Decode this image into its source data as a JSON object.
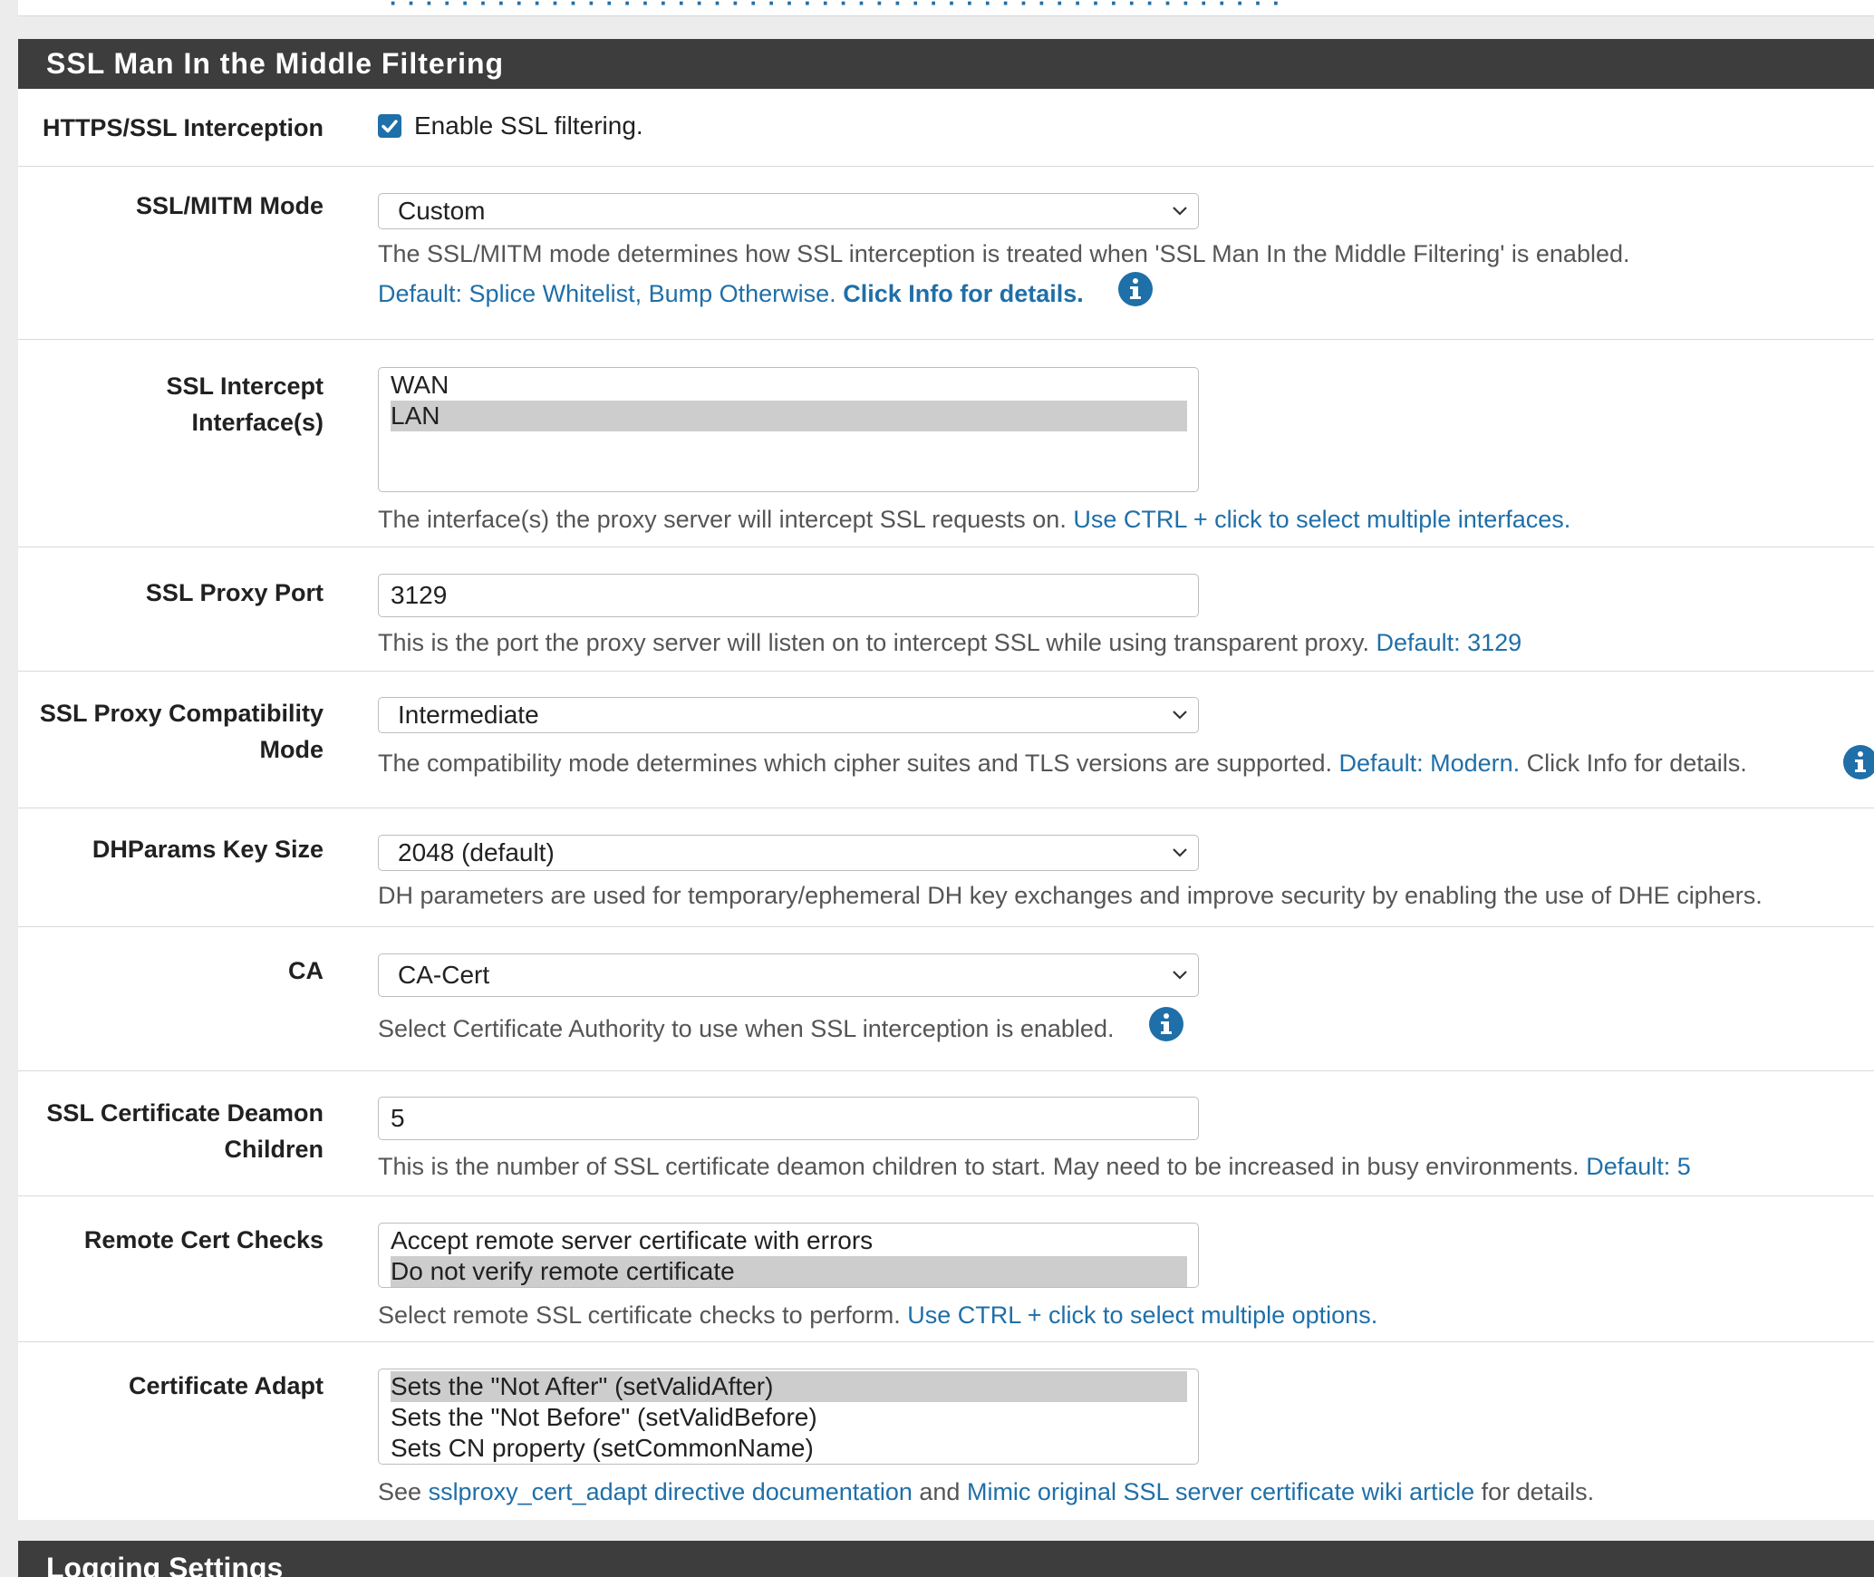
{
  "panel": {
    "title": "SSL Man In the Middle Filtering"
  },
  "rows": {
    "interception": {
      "label": "HTTPS/SSL Interception",
      "checkbox_label": "Enable SSL filtering.",
      "checked": true
    },
    "mitm_mode": {
      "label": "SSL/MITM Mode",
      "selected": "Custom",
      "help_text": "The SSL/MITM mode determines how SSL interception is treated when 'SSL Man In the Middle Filtering' is enabled.",
      "default_text": "Default: Splice Whitelist, Bump Otherwise.",
      "info_text": "Click Info for details."
    },
    "intercept_interfaces": {
      "label": "SSL Intercept Interface(s)",
      "options": [
        {
          "label": "WAN",
          "selected": false
        },
        {
          "label": "LAN",
          "selected": true
        }
      ],
      "help_text": "The interface(s) the proxy server will intercept SSL requests on.",
      "help_link": "Use CTRL + click to select multiple interfaces."
    },
    "proxy_port": {
      "label": "SSL Proxy Port",
      "value": "3129",
      "help_text": "This is the port the proxy server will listen on to intercept SSL while using transparent proxy.",
      "default_text": "Default: 3129"
    },
    "compat_mode": {
      "label": "SSL Proxy Compatibility Mode",
      "selected": "Intermediate",
      "help_text": "The compatibility mode determines which cipher suites and TLS versions are supported.",
      "default_text": "Default: Modern.",
      "info_text": "Click Info for details."
    },
    "dhparams": {
      "label": "DHParams Key Size",
      "selected": "2048 (default)",
      "help_text": "DH parameters are used for temporary/ephemeral DH key exchanges and improve security by enabling the use of DHE ciphers."
    },
    "ca": {
      "label": "CA",
      "selected": "CA-Cert",
      "help_text": "Select Certificate Authority to use when SSL interception is enabled."
    },
    "cert_children": {
      "label": "SSL Certificate Deamon Children",
      "value": "5",
      "help_text": "This is the number of SSL certificate deamon children to start. May need to be increased in busy environments.",
      "default_text": "Default: 5"
    },
    "remote_cert_checks": {
      "label": "Remote Cert Checks",
      "options": [
        {
          "label": "Accept remote server certificate with errors",
          "selected": false
        },
        {
          "label": "Do not verify remote certificate",
          "selected": true
        }
      ],
      "help_text": "Select remote SSL certificate checks to perform.",
      "help_link": "Use CTRL + click to select multiple options."
    },
    "cert_adapt": {
      "label": "Certificate Adapt",
      "options": [
        {
          "label": "Sets the \"Not After\" (setValidAfter)",
          "selected": true
        },
        {
          "label": "Sets the \"Not Before\" (setValidBefore)",
          "selected": false
        },
        {
          "label": "Sets CN property (setCommonName)",
          "selected": false
        }
      ],
      "help_prefix": "See",
      "link1": "sslproxy_cert_adapt directive documentation",
      "help_mid": "and",
      "link2": "Mimic original SSL server certificate wiki article",
      "help_suffix": "for details."
    }
  },
  "next_panel": {
    "title": "Logging Settings"
  },
  "colors": {
    "heading_bg": "#3d3d3d",
    "link": "#1f6fa8",
    "selected_option_bg": "#cdcdcd"
  },
  "icons": {
    "info": "info-circle-icon",
    "chevron": "chevron-down-icon",
    "check": "check-icon"
  }
}
